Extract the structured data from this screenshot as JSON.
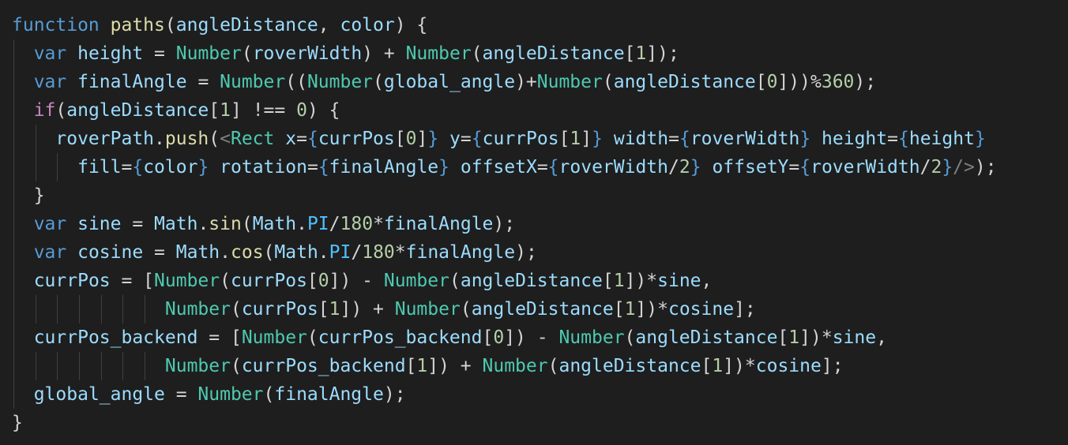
{
  "theme": {
    "background": "#1e1e1e",
    "indent_guide": "#404040",
    "token_colors": {
      "keyword": "#569cd6",
      "function": "#dcdcaa",
      "variable": "#9cdcfe",
      "constant": "#4fc1ff",
      "type": "#4ec9b0",
      "number": "#b5cea8",
      "control": "#c586c0",
      "punctuation": "#d4d4d4",
      "tag_bracket": "#808080"
    }
  },
  "code_lines": [
    {
      "indent": 0,
      "tokens": [
        {
          "t": "function",
          "c": "keyword"
        },
        {
          "t": " ",
          "c": "punctuation"
        },
        {
          "t": "paths",
          "c": "function"
        },
        {
          "t": "(",
          "c": "punctuation"
        },
        {
          "t": "angleDistance",
          "c": "variable"
        },
        {
          "t": ", ",
          "c": "punctuation"
        },
        {
          "t": "color",
          "c": "variable"
        },
        {
          "t": ") {",
          "c": "punctuation"
        }
      ]
    },
    {
      "indent": 1,
      "tokens": [
        {
          "t": "var",
          "c": "keyword"
        },
        {
          "t": " ",
          "c": "punctuation"
        },
        {
          "t": "height",
          "c": "variable"
        },
        {
          "t": " = ",
          "c": "punctuation"
        },
        {
          "t": "Number",
          "c": "type"
        },
        {
          "t": "(",
          "c": "punctuation"
        },
        {
          "t": "roverWidth",
          "c": "variable"
        },
        {
          "t": ") + ",
          "c": "punctuation"
        },
        {
          "t": "Number",
          "c": "type"
        },
        {
          "t": "(",
          "c": "punctuation"
        },
        {
          "t": "angleDistance",
          "c": "variable"
        },
        {
          "t": "[",
          "c": "punctuation"
        },
        {
          "t": "1",
          "c": "number"
        },
        {
          "t": "]);",
          "c": "punctuation"
        }
      ]
    },
    {
      "indent": 1,
      "tokens": [
        {
          "t": "var",
          "c": "keyword"
        },
        {
          "t": " ",
          "c": "punctuation"
        },
        {
          "t": "finalAngle",
          "c": "variable"
        },
        {
          "t": " = ",
          "c": "punctuation"
        },
        {
          "t": "Number",
          "c": "type"
        },
        {
          "t": "((",
          "c": "punctuation"
        },
        {
          "t": "Number",
          "c": "type"
        },
        {
          "t": "(",
          "c": "punctuation"
        },
        {
          "t": "global_angle",
          "c": "variable"
        },
        {
          "t": ")+",
          "c": "punctuation"
        },
        {
          "t": "Number",
          "c": "type"
        },
        {
          "t": "(",
          "c": "punctuation"
        },
        {
          "t": "angleDistance",
          "c": "variable"
        },
        {
          "t": "[",
          "c": "punctuation"
        },
        {
          "t": "0",
          "c": "number"
        },
        {
          "t": "]))%",
          "c": "punctuation"
        },
        {
          "t": "360",
          "c": "number"
        },
        {
          "t": ");",
          "c": "punctuation"
        }
      ]
    },
    {
      "indent": 1,
      "tokens": [
        {
          "t": "if",
          "c": "control"
        },
        {
          "t": "(",
          "c": "punctuation"
        },
        {
          "t": "angleDistance",
          "c": "variable"
        },
        {
          "t": "[",
          "c": "punctuation"
        },
        {
          "t": "1",
          "c": "number"
        },
        {
          "t": "] !== ",
          "c": "punctuation"
        },
        {
          "t": "0",
          "c": "number"
        },
        {
          "t": ") {",
          "c": "punctuation"
        }
      ]
    },
    {
      "indent": 2,
      "tokens": [
        {
          "t": "roverPath",
          "c": "variable"
        },
        {
          "t": ".",
          "c": "punctuation"
        },
        {
          "t": "push",
          "c": "function"
        },
        {
          "t": "(",
          "c": "punctuation"
        },
        {
          "t": "<",
          "c": "tag_bracket"
        },
        {
          "t": "Rect",
          "c": "type"
        },
        {
          "t": " ",
          "c": "punctuation"
        },
        {
          "t": "x",
          "c": "variable"
        },
        {
          "t": "=",
          "c": "punctuation"
        },
        {
          "t": "{",
          "c": "keyword"
        },
        {
          "t": "currPos",
          "c": "variable"
        },
        {
          "t": "[",
          "c": "punctuation"
        },
        {
          "t": "0",
          "c": "number"
        },
        {
          "t": "]",
          "c": "punctuation"
        },
        {
          "t": "}",
          "c": "keyword"
        },
        {
          "t": " ",
          "c": "punctuation"
        },
        {
          "t": "y",
          "c": "variable"
        },
        {
          "t": "=",
          "c": "punctuation"
        },
        {
          "t": "{",
          "c": "keyword"
        },
        {
          "t": "currPos",
          "c": "variable"
        },
        {
          "t": "[",
          "c": "punctuation"
        },
        {
          "t": "1",
          "c": "number"
        },
        {
          "t": "]",
          "c": "punctuation"
        },
        {
          "t": "}",
          "c": "keyword"
        },
        {
          "t": " ",
          "c": "punctuation"
        },
        {
          "t": "width",
          "c": "variable"
        },
        {
          "t": "=",
          "c": "punctuation"
        },
        {
          "t": "{",
          "c": "keyword"
        },
        {
          "t": "roverWidth",
          "c": "variable"
        },
        {
          "t": "}",
          "c": "keyword"
        },
        {
          "t": " ",
          "c": "punctuation"
        },
        {
          "t": "height",
          "c": "variable"
        },
        {
          "t": "=",
          "c": "punctuation"
        },
        {
          "t": "{",
          "c": "keyword"
        },
        {
          "t": "height",
          "c": "variable"
        },
        {
          "t": "}",
          "c": "keyword"
        }
      ]
    },
    {
      "indent": 3,
      "tokens": [
        {
          "t": "fill",
          "c": "variable"
        },
        {
          "t": "=",
          "c": "punctuation"
        },
        {
          "t": "{",
          "c": "keyword"
        },
        {
          "t": "color",
          "c": "variable"
        },
        {
          "t": "}",
          "c": "keyword"
        },
        {
          "t": " ",
          "c": "punctuation"
        },
        {
          "t": "rotation",
          "c": "variable"
        },
        {
          "t": "=",
          "c": "punctuation"
        },
        {
          "t": "{",
          "c": "keyword"
        },
        {
          "t": "finalAngle",
          "c": "variable"
        },
        {
          "t": "}",
          "c": "keyword"
        },
        {
          "t": " ",
          "c": "punctuation"
        },
        {
          "t": "offsetX",
          "c": "variable"
        },
        {
          "t": "=",
          "c": "punctuation"
        },
        {
          "t": "{",
          "c": "keyword"
        },
        {
          "t": "roverWidth",
          "c": "variable"
        },
        {
          "t": "/",
          "c": "punctuation"
        },
        {
          "t": "2",
          "c": "number"
        },
        {
          "t": "}",
          "c": "keyword"
        },
        {
          "t": " ",
          "c": "punctuation"
        },
        {
          "t": "offsetY",
          "c": "variable"
        },
        {
          "t": "=",
          "c": "punctuation"
        },
        {
          "t": "{",
          "c": "keyword"
        },
        {
          "t": "roverWidth",
          "c": "variable"
        },
        {
          "t": "/",
          "c": "punctuation"
        },
        {
          "t": "2",
          "c": "number"
        },
        {
          "t": "}",
          "c": "keyword"
        },
        {
          "t": "/>",
          "c": "tag_bracket"
        },
        {
          "t": ");",
          "c": "punctuation"
        }
      ]
    },
    {
      "indent": 1,
      "tokens": [
        {
          "t": "}",
          "c": "punctuation"
        }
      ]
    },
    {
      "indent": 1,
      "tokens": [
        {
          "t": "var",
          "c": "keyword"
        },
        {
          "t": " ",
          "c": "punctuation"
        },
        {
          "t": "sine",
          "c": "variable"
        },
        {
          "t": " = ",
          "c": "punctuation"
        },
        {
          "t": "Math",
          "c": "variable"
        },
        {
          "t": ".",
          "c": "punctuation"
        },
        {
          "t": "sin",
          "c": "function"
        },
        {
          "t": "(",
          "c": "punctuation"
        },
        {
          "t": "Math",
          "c": "variable"
        },
        {
          "t": ".",
          "c": "punctuation"
        },
        {
          "t": "PI",
          "c": "constant"
        },
        {
          "t": "/",
          "c": "punctuation"
        },
        {
          "t": "180",
          "c": "number"
        },
        {
          "t": "*",
          "c": "punctuation"
        },
        {
          "t": "finalAngle",
          "c": "variable"
        },
        {
          "t": ");",
          "c": "punctuation"
        }
      ]
    },
    {
      "indent": 1,
      "tokens": [
        {
          "t": "var",
          "c": "keyword"
        },
        {
          "t": " ",
          "c": "punctuation"
        },
        {
          "t": "cosine",
          "c": "variable"
        },
        {
          "t": " = ",
          "c": "punctuation"
        },
        {
          "t": "Math",
          "c": "variable"
        },
        {
          "t": ".",
          "c": "punctuation"
        },
        {
          "t": "cos",
          "c": "function"
        },
        {
          "t": "(",
          "c": "punctuation"
        },
        {
          "t": "Math",
          "c": "variable"
        },
        {
          "t": ".",
          "c": "punctuation"
        },
        {
          "t": "PI",
          "c": "constant"
        },
        {
          "t": "/",
          "c": "punctuation"
        },
        {
          "t": "180",
          "c": "number"
        },
        {
          "t": "*",
          "c": "punctuation"
        },
        {
          "t": "finalAngle",
          "c": "variable"
        },
        {
          "t": ");",
          "c": "punctuation"
        }
      ]
    },
    {
      "indent": 1,
      "tokens": [
        {
          "t": "currPos",
          "c": "variable"
        },
        {
          "t": " = [",
          "c": "punctuation"
        },
        {
          "t": "Number",
          "c": "type"
        },
        {
          "t": "(",
          "c": "punctuation"
        },
        {
          "t": "currPos",
          "c": "variable"
        },
        {
          "t": "[",
          "c": "punctuation"
        },
        {
          "t": "0",
          "c": "number"
        },
        {
          "t": "]) - ",
          "c": "punctuation"
        },
        {
          "t": "Number",
          "c": "type"
        },
        {
          "t": "(",
          "c": "punctuation"
        },
        {
          "t": "angleDistance",
          "c": "variable"
        },
        {
          "t": "[",
          "c": "punctuation"
        },
        {
          "t": "1",
          "c": "number"
        },
        {
          "t": "])*",
          "c": "punctuation"
        },
        {
          "t": "sine",
          "c": "variable"
        },
        {
          "t": ",",
          "c": "punctuation"
        }
      ]
    },
    {
      "indent": 7,
      "tokens": [
        {
          "t": "Number",
          "c": "type"
        },
        {
          "t": "(",
          "c": "punctuation"
        },
        {
          "t": "currPos",
          "c": "variable"
        },
        {
          "t": "[",
          "c": "punctuation"
        },
        {
          "t": "1",
          "c": "number"
        },
        {
          "t": "]) + ",
          "c": "punctuation"
        },
        {
          "t": "Number",
          "c": "type"
        },
        {
          "t": "(",
          "c": "punctuation"
        },
        {
          "t": "angleDistance",
          "c": "variable"
        },
        {
          "t": "[",
          "c": "punctuation"
        },
        {
          "t": "1",
          "c": "number"
        },
        {
          "t": "])*",
          "c": "punctuation"
        },
        {
          "t": "cosine",
          "c": "variable"
        },
        {
          "t": "];",
          "c": "punctuation"
        }
      ]
    },
    {
      "indent": 1,
      "tokens": [
        {
          "t": "currPos_backend",
          "c": "variable"
        },
        {
          "t": " = [",
          "c": "punctuation"
        },
        {
          "t": "Number",
          "c": "type"
        },
        {
          "t": "(",
          "c": "punctuation"
        },
        {
          "t": "currPos_backend",
          "c": "variable"
        },
        {
          "t": "[",
          "c": "punctuation"
        },
        {
          "t": "0",
          "c": "number"
        },
        {
          "t": "]) - ",
          "c": "punctuation"
        },
        {
          "t": "Number",
          "c": "type"
        },
        {
          "t": "(",
          "c": "punctuation"
        },
        {
          "t": "angleDistance",
          "c": "variable"
        },
        {
          "t": "[",
          "c": "punctuation"
        },
        {
          "t": "1",
          "c": "number"
        },
        {
          "t": "])*",
          "c": "punctuation"
        },
        {
          "t": "sine",
          "c": "variable"
        },
        {
          "t": ",",
          "c": "punctuation"
        }
      ]
    },
    {
      "indent": 7,
      "tokens": [
        {
          "t": "Number",
          "c": "type"
        },
        {
          "t": "(",
          "c": "punctuation"
        },
        {
          "t": "currPos_backend",
          "c": "variable"
        },
        {
          "t": "[",
          "c": "punctuation"
        },
        {
          "t": "1",
          "c": "number"
        },
        {
          "t": "]) + ",
          "c": "punctuation"
        },
        {
          "t": "Number",
          "c": "type"
        },
        {
          "t": "(",
          "c": "punctuation"
        },
        {
          "t": "angleDistance",
          "c": "variable"
        },
        {
          "t": "[",
          "c": "punctuation"
        },
        {
          "t": "1",
          "c": "number"
        },
        {
          "t": "])*",
          "c": "punctuation"
        },
        {
          "t": "cosine",
          "c": "variable"
        },
        {
          "t": "];",
          "c": "punctuation"
        }
      ]
    },
    {
      "indent": 1,
      "tokens": [
        {
          "t": "global_angle",
          "c": "variable"
        },
        {
          "t": " = ",
          "c": "punctuation"
        },
        {
          "t": "Number",
          "c": "type"
        },
        {
          "t": "(",
          "c": "punctuation"
        },
        {
          "t": "finalAngle",
          "c": "variable"
        },
        {
          "t": ");",
          "c": "punctuation"
        }
      ]
    },
    {
      "indent": 0,
      "tokens": [
        {
          "t": "}",
          "c": "punctuation"
        }
      ]
    }
  ]
}
